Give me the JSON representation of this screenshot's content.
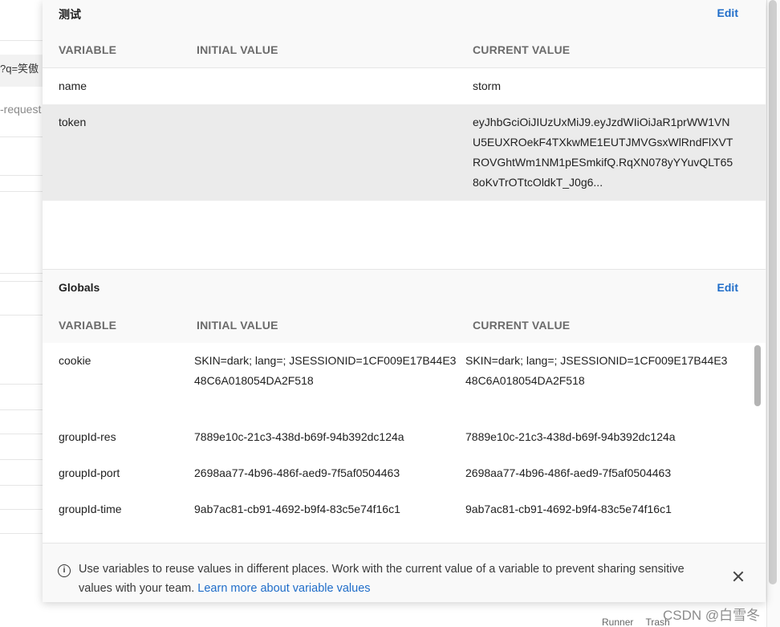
{
  "background": {
    "url_fragment": "?q=笑傲",
    "request_fragment": "-request",
    "bottom_items": [
      "Runner",
      "Trash"
    ]
  },
  "watermark": "CSDN @白雪冬",
  "env_section": {
    "title": "测试",
    "edit_label": "Edit",
    "columns": [
      "VARIABLE",
      "INITIAL VALUE",
      "CURRENT VALUE"
    ],
    "rows": [
      {
        "variable": "name",
        "initial": "",
        "current": "storm"
      },
      {
        "variable": "token",
        "initial": "",
        "current": "eyJhbGciOiJIUzUxMiJ9.eyJzdWIiOiJaR1prWW1VNU5EUXROekF4TXkwME1EUTJMVGsxWlRndFlXVTROVGhtWm1NM1pESmkifQ.RqXN078yYYuvQLT658oKvTrOTtcOldkT_J0g6..."
      }
    ]
  },
  "globals_section": {
    "title": "Globals",
    "edit_label": "Edit",
    "columns": [
      "VARIABLE",
      "INITIAL VALUE",
      "CURRENT VALUE"
    ],
    "rows": [
      {
        "variable": "cookie",
        "initial": "SKIN=dark; lang=; JSESSIONID=1CF009E17B44E348C6A018054DA2F518",
        "current": "SKIN=dark; lang=; JSESSIONID=1CF009E17B44E348C6A018054DA2F518"
      },
      {
        "variable": "groupId-res",
        "initial": "7889e10c-21c3-438d-b69f-94b392dc124a",
        "current": "7889e10c-21c3-438d-b69f-94b392dc124a"
      },
      {
        "variable": "groupId-port",
        "initial": "2698aa77-4b96-486f-aed9-7f5af0504463",
        "current": "2698aa77-4b96-486f-aed9-7f5af0504463"
      },
      {
        "variable": "groupId-time",
        "initial": "9ab7ac81-cb91-4692-b9f4-83c5e74f16c1",
        "current": "9ab7ac81-cb91-4692-b9f4-83c5e74f16c1"
      }
    ]
  },
  "info_banner": {
    "text": "Use variables to reuse values in different places. Work with the current value of a variable to prevent sharing sensitive values with your team.",
    "link": "Learn more about variable values"
  },
  "icons": {
    "info": "info-icon",
    "close": "close-icon"
  }
}
